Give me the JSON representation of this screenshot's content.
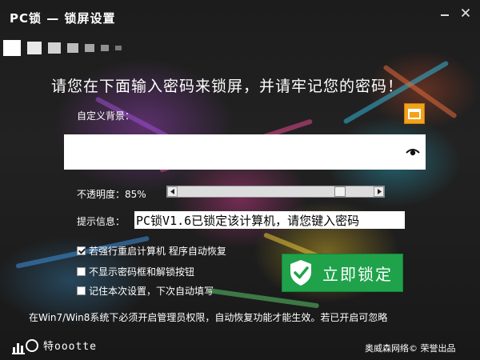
{
  "window": {
    "title": "PC锁 — 锁屏设置",
    "minimize_icon": "minimize-icon",
    "close_icon": "close-icon"
  },
  "headline": "请您在下面输入密码来锁屏，并请牢记您的密码！",
  "background": {
    "label": "自定义背景：",
    "value": "",
    "folder_icon": "folder-icon",
    "eye_icon": "eye-icon"
  },
  "opacity": {
    "label": "不透明度：85%",
    "level": 0.85
  },
  "tip": {
    "label": "提示信息：",
    "value": "PC锁V1.6已锁定该计算机，请您键入密码"
  },
  "options": [
    {
      "label": "若强行重启计算机 程序自动恢复",
      "checked": true
    },
    {
      "label": "不显示密码框和解锁按钮",
      "checked": false
    },
    {
      "label": "记住本次设置，下次自动填写",
      "checked": false
    }
  ],
  "lock_button": {
    "label": "立即锁定",
    "icon": "shield-check-icon",
    "color": "#1fa24a"
  },
  "note": "在Win7/Win8系统下必须开启管理员权限，自动恢复功能才能生效。若已开启可忽略",
  "footer": {
    "logo_text": "特oootte",
    "credit": "奥威森网络© 荣誉出品"
  }
}
